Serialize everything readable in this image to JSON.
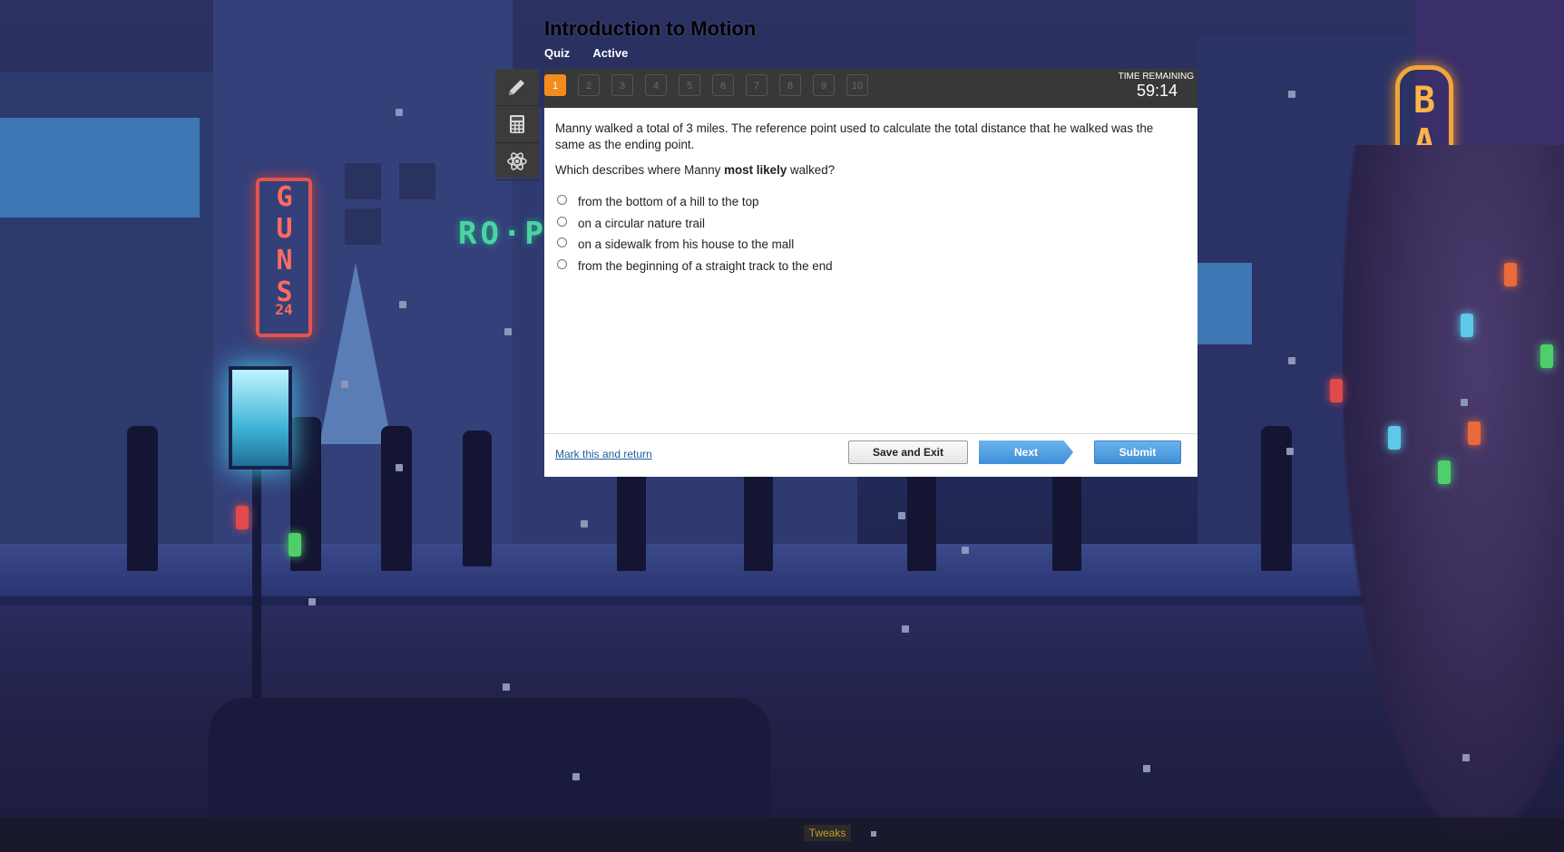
{
  "quiz": {
    "title": "Introduction to Motion",
    "type_label": "Quiz",
    "status_label": "Active"
  },
  "tools": [
    {
      "icon": "pencil-icon"
    },
    {
      "icon": "calculator-icon"
    },
    {
      "icon": "atom-icon"
    }
  ],
  "question_nav": {
    "numbers": [
      "1",
      "2",
      "3",
      "4",
      "5",
      "6",
      "7",
      "8",
      "9",
      "10"
    ],
    "current": "1"
  },
  "timer": {
    "label": "TIME REMAINING",
    "value": "59:14"
  },
  "question": {
    "text": "Manny walked a total of 3 miles. The reference point used to calculate the total distance that he walked was the same as the ending point.",
    "prompt_before": "Which describes where Manny ",
    "prompt_bold": "most likely",
    "prompt_after": " walked?",
    "options": [
      "from the bottom of a hill to the top",
      "on a circular nature trail",
      "on a sidewalk from his house to the mall",
      "from the beginning of a straight track to the end"
    ]
  },
  "footer": {
    "mark_label": "Mark this and return",
    "save_label": "Save and Exit",
    "next_label": "Next",
    "submit_label": "Submit"
  },
  "background": {
    "sign_guns": "GUNS",
    "sign_guns_num": "24",
    "sign_bar": "BAR",
    "sign_ro": "RO·PF"
  },
  "overlay": {
    "tweaks_label": "Tweaks"
  },
  "colors": {
    "accent_orange": "#f28c1e",
    "button_blue": "#4a9be0",
    "link_blue": "#1d5d9e",
    "bar_dark": "#383838"
  }
}
